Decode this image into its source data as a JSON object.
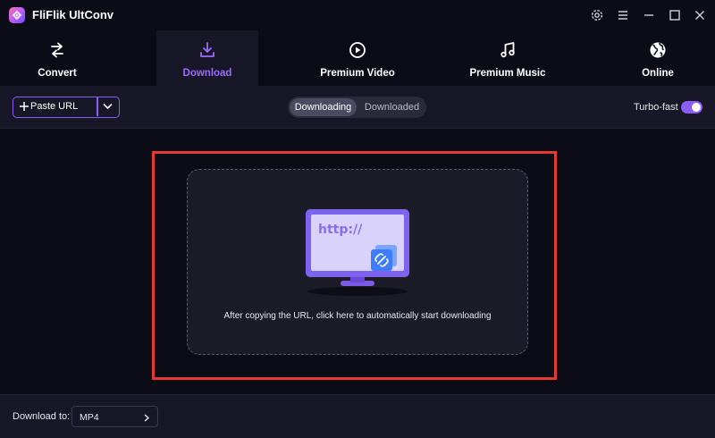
{
  "app": {
    "title": "FliFlik UltConv"
  },
  "window_controls": [
    "settings-icon",
    "menu-icon",
    "minimize-icon",
    "maximize-icon",
    "close-icon"
  ],
  "nav": {
    "tabs": [
      {
        "label": "Convert",
        "icon": "convert-arrows-icon",
        "active": false
      },
      {
        "label": "Download",
        "icon": "download-icon",
        "active": true
      },
      {
        "label": "Premium Video",
        "icon": "play-circle-icon",
        "active": false
      },
      {
        "label": "Premium Music",
        "icon": "music-note-icon",
        "active": false
      },
      {
        "label": "Online",
        "icon": "globe-icon",
        "active": false
      }
    ]
  },
  "toolbar": {
    "paste_label": "Paste URL",
    "segments": {
      "downloading": "Downloading",
      "downloaded": "Downloaded",
      "selected": "Downloading"
    },
    "turbo_label": "Turbo-fast",
    "turbo_on": true
  },
  "dropzone": {
    "illustration_text": "http://",
    "instruction": "After copying the URL, click here to automatically start downloading"
  },
  "footer": {
    "download_to_label": "Download to:",
    "format_value": "MP4"
  },
  "colors": {
    "accent": "#8b5cf6",
    "active_tab_label": "#9d6bff",
    "highlight_border": "#e53935",
    "background": "#0c0c17",
    "panel": "#171727"
  }
}
